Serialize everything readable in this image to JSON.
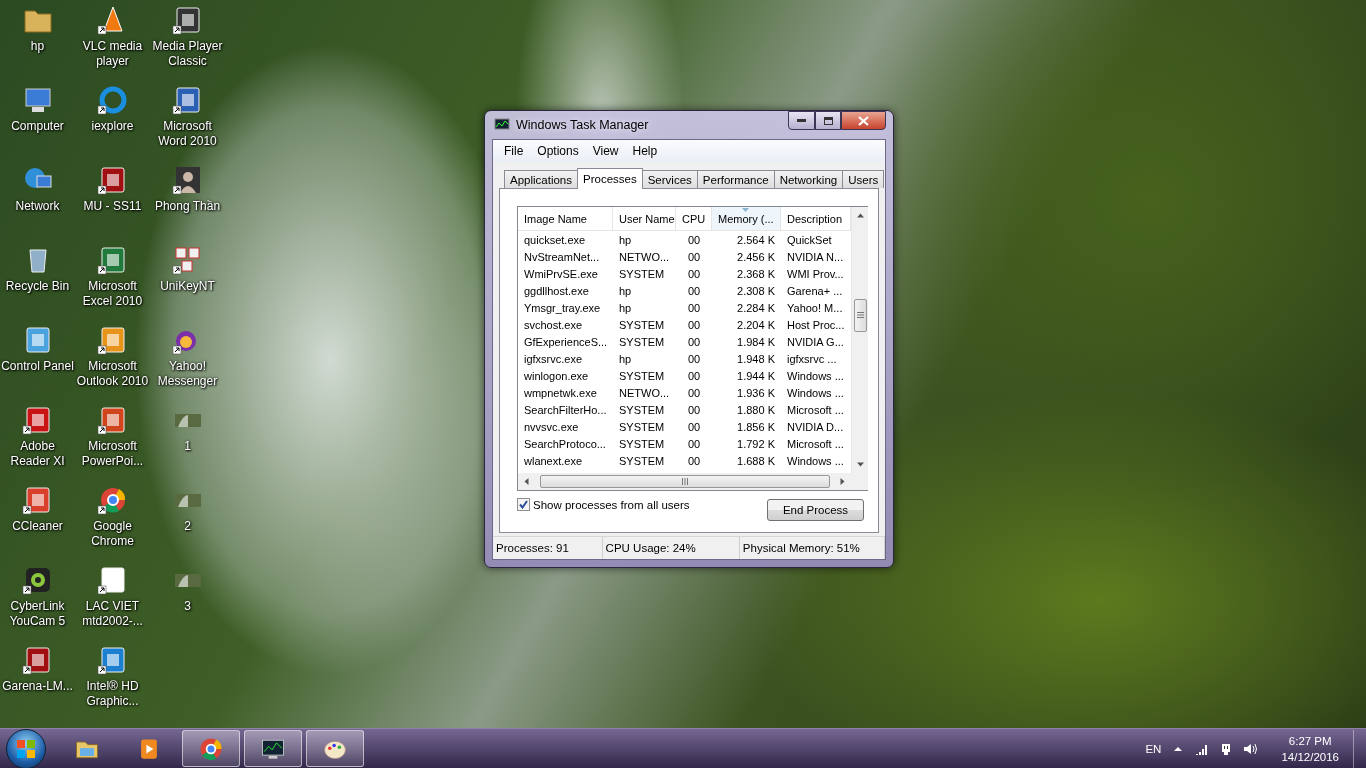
{
  "desktop_icons": [
    {
      "label": "hp",
      "kind": "folder",
      "shortcut": false
    },
    {
      "label": "Computer",
      "kind": "monitor",
      "shortcut": false
    },
    {
      "label": "Network",
      "kind": "globe",
      "shortcut": false
    },
    {
      "label": "Recycle Bin",
      "kind": "bin",
      "shortcut": false
    },
    {
      "label": "Control Panel",
      "kind": "panel",
      "shortcut": false
    },
    {
      "label": "Adobe Reader XI",
      "kind": "pdf",
      "shortcut": true
    },
    {
      "label": "CCleaner",
      "kind": "brush",
      "shortcut": true
    },
    {
      "label": "CyberLink YouCam 5",
      "kind": "camera",
      "shortcut": true
    },
    {
      "label": "Garena-LM...",
      "kind": "game",
      "shortcut": true
    },
    {
      "label": "VLC media player",
      "kind": "cone",
      "shortcut": true
    },
    {
      "label": "iexplore",
      "kind": "browser",
      "shortcut": true
    },
    {
      "label": "MU - SS11",
      "kind": "game",
      "shortcut": true
    },
    {
      "label": "Microsoft Excel 2010",
      "kind": "sheet",
      "shortcut": true
    },
    {
      "label": "Microsoft Outlook 2010",
      "kind": "mail",
      "shortcut": true
    },
    {
      "label": "Microsoft PowerPoi...",
      "kind": "slides",
      "shortcut": true
    },
    {
      "label": "Google Chrome",
      "kind": "chrome",
      "shortcut": true
    },
    {
      "label": "LAC VIET mtd2002-...",
      "kind": "dictionary",
      "shortcut": true
    },
    {
      "label": "Intel® HD Graphic...",
      "kind": "chip",
      "shortcut": true
    },
    {
      "label": "Media Player Classic",
      "kind": "film",
      "shortcut": true
    },
    {
      "label": "Microsoft Word 2010",
      "kind": "document",
      "shortcut": true
    },
    {
      "label": "Phong Thần",
      "kind": "person",
      "shortcut": true
    },
    {
      "label": "UniKeyNT",
      "kind": "keys",
      "shortcut": true
    },
    {
      "label": "Yahoo! Messenger",
      "kind": "chat",
      "shortcut": true
    },
    {
      "label": "1",
      "kind": "thumb",
      "shortcut": false
    },
    {
      "label": "2",
      "kind": "thumb",
      "shortcut": false
    },
    {
      "label": "3",
      "kind": "thumb",
      "shortcut": false
    }
  ],
  "window": {
    "title": "Windows Task Manager",
    "menu": [
      "File",
      "Options",
      "View",
      "Help"
    ],
    "tabs": [
      {
        "label": "Applications",
        "selected": false
      },
      {
        "label": "Processes",
        "selected": true
      },
      {
        "label": "Services",
        "selected": false
      },
      {
        "label": "Performance",
        "selected": false
      },
      {
        "label": "Networking",
        "selected": false
      },
      {
        "label": "Users",
        "selected": false
      }
    ],
    "table": {
      "columns": [
        {
          "label": "Image Name",
          "sorted": false
        },
        {
          "label": "User Name",
          "sorted": false
        },
        {
          "label": "CPU",
          "sorted": false
        },
        {
          "label": "Memory (...",
          "sorted": true
        },
        {
          "label": "Description",
          "sorted": false
        }
      ],
      "rows": [
        [
          "quickset.exe",
          "hp",
          "00",
          "2.564 K",
          "QuickSet"
        ],
        [
          "NvStreamNet...",
          "NETWO...",
          "00",
          "2.456 K",
          "NVIDIA N..."
        ],
        [
          "WmiPrvSE.exe",
          "SYSTEM",
          "00",
          "2.368 K",
          "WMI Prov..."
        ],
        [
          "ggdllhost.exe",
          "hp",
          "00",
          "2.308 K",
          "Garena+ ..."
        ],
        [
          "Ymsgr_tray.exe",
          "hp",
          "00",
          "2.284 K",
          "Yahoo! M..."
        ],
        [
          "svchost.exe",
          "SYSTEM",
          "00",
          "2.204 K",
          "Host Proc..."
        ],
        [
          "GfExperienceS...",
          "SYSTEM",
          "00",
          "1.984 K",
          "NVIDIA G..."
        ],
        [
          "igfxsrvc.exe",
          "hp",
          "00",
          "1.948 K",
          "igfxsrvc ..."
        ],
        [
          "winlogon.exe",
          "SYSTEM",
          "00",
          "1.944 K",
          "Windows ..."
        ],
        [
          "wmpnetwk.exe",
          "NETWO...",
          "00",
          "1.936 K",
          "Windows ..."
        ],
        [
          "SearchFilterHo...",
          "SYSTEM",
          "00",
          "1.880 K",
          "Microsoft ..."
        ],
        [
          "nvvsvc.exe",
          "SYSTEM",
          "00",
          "1.856 K",
          "NVIDIA D..."
        ],
        [
          "SearchProtoco...",
          "SYSTEM",
          "00",
          "1.792 K",
          "Microsoft ..."
        ],
        [
          "wlanext.exe",
          "SYSTEM",
          "00",
          "1.688 K",
          "Windows ..."
        ]
      ]
    },
    "show_all_users": {
      "label": "Show processes from all users",
      "checked": true
    },
    "end_button": "End Process",
    "status_bar": [
      "Processes: 91",
      "CPU Usage: 24%",
      "Physical Memory: 51%"
    ]
  },
  "taskbar": {
    "apps": [
      {
        "kind": "explorer",
        "running": false
      },
      {
        "kind": "media",
        "running": false
      },
      {
        "kind": "chrome",
        "running": true
      },
      {
        "kind": "taskmgr",
        "running": true
      },
      {
        "kind": "paint",
        "running": true
      }
    ],
    "language": "EN",
    "time": "6:27 PM",
    "date": "14/12/2016"
  }
}
